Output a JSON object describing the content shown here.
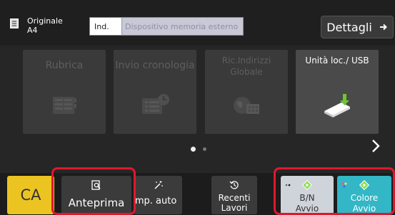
{
  "header": {
    "original_label": "Originale",
    "original_size": "A4",
    "address_prefix": "Ind.",
    "address_placeholder": "Dispositivo memoria esterno",
    "details_label": "Dettagli"
  },
  "tiles": [
    {
      "label": "Rubrica",
      "icon": "address-book-icon",
      "enabled": false
    },
    {
      "label": "Invio cronologia",
      "icon": "send-history-icon",
      "enabled": false
    },
    {
      "label": "Ric.Indirizzi Globale",
      "icon": "global-address-search-icon",
      "enabled": false
    },
    {
      "label": "Unità loc./ USB",
      "icon": "usb-local-drive-icon",
      "enabled": true
    }
  ],
  "pager": {
    "current_page": 1,
    "total_pages": 2
  },
  "bottom_bar": {
    "ca_label": "CA",
    "preview_label": "Anteprima",
    "impauto_label": "Imp. auto",
    "recent_label_line1": "Recenti",
    "recent_label_line2": "Lavori",
    "bw_label_line1": "B/N",
    "bw_label_line2": "Avvio",
    "color_label_line1": "Colore",
    "color_label_line2": "Avvio"
  },
  "colors": {
    "ca": "#ecc422",
    "color_start": "#33b7c6",
    "bw_start": "#cfd3da",
    "highlight": "#e0182d",
    "start_diamond": "#8be04a"
  }
}
